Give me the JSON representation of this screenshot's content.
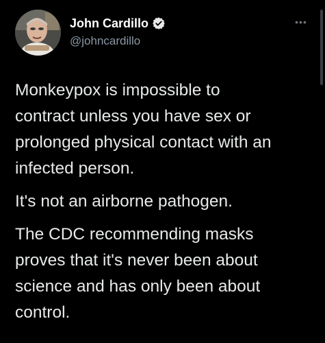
{
  "author": {
    "display_name": "John Cardillo",
    "handle": "@johncardillo",
    "verified": true,
    "avatar_icon": "profile-photo"
  },
  "menu": {
    "more_label": "•••"
  },
  "tweet": {
    "paragraphs": [
      {
        "lines": [
          "Monkeypox is impossible to",
          "contract unless you have sex or",
          "prolonged physical contact with an",
          "infected person."
        ]
      },
      {
        "lines": [
          "It's not an airborne pathogen."
        ]
      },
      {
        "lines": [
          "The CDC recommending masks",
          "proves that it's never been about",
          "science and has only been about",
          "control."
        ]
      }
    ]
  },
  "colors": {
    "background": "#000000",
    "text": "#e7e9ea",
    "secondary": "#8b98a5",
    "verified_badge": "#e7e9ea"
  }
}
